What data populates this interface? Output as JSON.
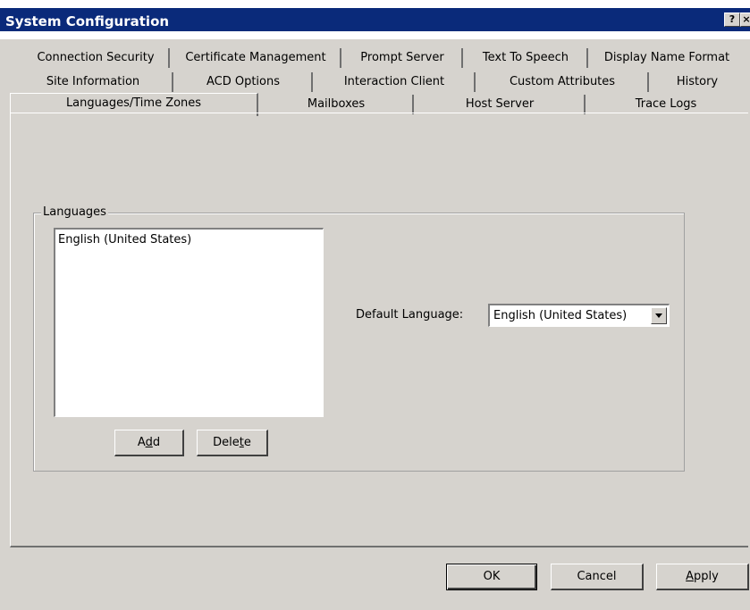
{
  "window": {
    "title": "System Configuration",
    "help_button": "?",
    "close_button": "×"
  },
  "tabs": {
    "row1": [
      "Connection Security",
      "Certificate Management",
      "Prompt Server",
      "Text To Speech",
      "Display Name Format"
    ],
    "row2": [
      "Site Information",
      "ACD Options",
      "Interaction Client",
      "Custom Attributes",
      "History"
    ],
    "row3": [
      "Languages/Time Zones",
      "Mailboxes",
      "Host Server",
      "Trace Logs"
    ],
    "selected": "Languages/Time Zones"
  },
  "languages": {
    "group_label": "Languages",
    "items": [
      "English (United States)"
    ],
    "add_button": {
      "pre": "A",
      "accel": "d",
      "post": "d"
    },
    "delete_button": {
      "pre": "Dele",
      "accel": "t",
      "post": "e"
    }
  },
  "default_language": {
    "label": "Default Language:",
    "value": "English (United States)"
  },
  "footer": {
    "ok": "OK",
    "cancel": "Cancel",
    "apply": {
      "pre": "",
      "accel": "A",
      "post": "pply"
    }
  }
}
